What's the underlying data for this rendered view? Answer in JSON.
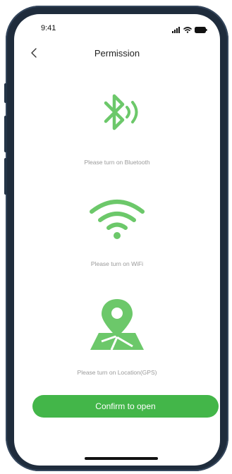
{
  "status_bar": {
    "time": "9:41",
    "icons": [
      "signal-icon",
      "wifi-icon",
      "battery-icon"
    ]
  },
  "nav": {
    "back_icon": "chevron-left-icon",
    "title": "Permission"
  },
  "permissions": [
    {
      "icon": "bluetooth-icon",
      "label": "Please turn on Bluetooth"
    },
    {
      "icon": "wifi-icon",
      "label": "Please turn on WiFi"
    },
    {
      "icon": "location-map-icon",
      "label": "Please turn on Location(GPS)"
    }
  ],
  "confirm_button": {
    "label": "Confirm to open"
  },
  "colors": {
    "accent_green": "#43b649",
    "icon_green": "#6cc86a",
    "label_gray": "#9a9a9a",
    "frame": "#1f2c3c"
  }
}
